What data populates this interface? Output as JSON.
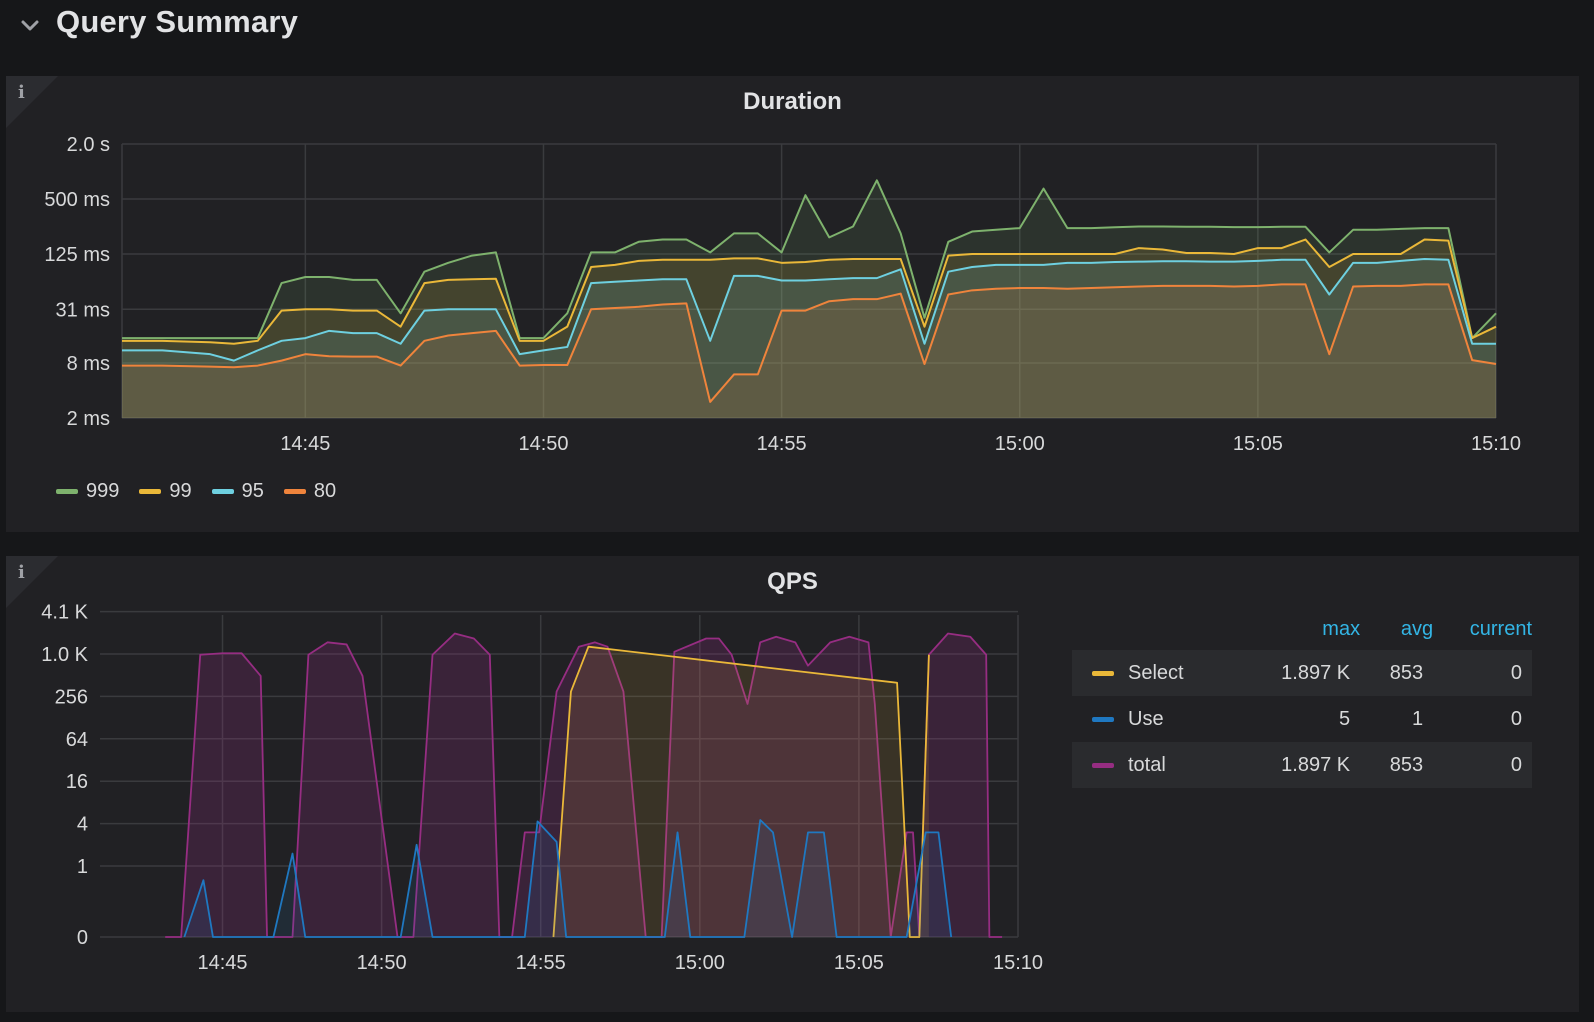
{
  "row": {
    "title": "Query Summary",
    "chevron_icon": "chevron-down-icon"
  },
  "panels": {
    "duration": {
      "title": "Duration",
      "info_icon": "i",
      "legend": [
        {
          "name": "999",
          "color": "#7eb26d"
        },
        {
          "name": "99",
          "color": "#eab839"
        },
        {
          "name": "95",
          "color": "#6ed0e0"
        },
        {
          "name": "80",
          "color": "#ef843c"
        }
      ]
    },
    "qps": {
      "title": "QPS",
      "info_icon": "i",
      "legend_table": {
        "headers": [
          "max",
          "avg",
          "current"
        ],
        "rows": [
          {
            "name": "Select",
            "color": "#eab839",
            "max": "1.897 K",
            "avg": "853",
            "current": "0"
          },
          {
            "name": "Use",
            "color": "#1f78c1",
            "max": "5",
            "avg": "1",
            "current": "0"
          },
          {
            "name": "total",
            "color": "#962d82",
            "max": "1.897 K",
            "avg": "853",
            "current": "0"
          }
        ]
      }
    }
  },
  "chart_data": [
    {
      "type": "area",
      "title": "Duration",
      "y_scale": "log",
      "y_ticks": [
        "2.0 s",
        "500 ms",
        "125 ms",
        "31 ms",
        "8 ms",
        "2 ms"
      ],
      "y_tick_values_ms": [
        2000,
        500,
        125,
        31,
        8,
        2
      ],
      "ylim_ms": [
        2,
        2000
      ],
      "x_ticks": [
        "14:45",
        "14:50",
        "14:55",
        "15:00",
        "15:05",
        "15:10"
      ],
      "x_tick_minutes": [
        45,
        50,
        55,
        60,
        65,
        70
      ],
      "xlim_minutes": [
        41.15,
        70
      ],
      "grid": true,
      "legend_position": "bottom-left",
      "x_minutes": [
        41.15,
        42,
        43,
        43.5,
        44,
        44.5,
        45,
        45.5,
        46,
        46.5,
        47,
        47.5,
        48,
        48.5,
        49,
        49.5,
        50,
        50.5,
        51,
        51.5,
        52,
        52.5,
        53,
        53.5,
        54,
        54.5,
        55,
        55.5,
        56,
        56.5,
        57,
        57.5,
        58,
        58.5,
        59,
        59.5,
        60,
        60.5,
        61,
        61.5,
        62,
        62.5,
        63,
        63.5,
        64,
        64.5,
        65,
        65.5,
        66,
        66.5,
        67,
        67.5,
        68,
        68.5,
        69,
        69.5,
        70
      ],
      "series": [
        {
          "name": "999",
          "color": "#7eb26d",
          "values": [
            15,
            15,
            15,
            15,
            15,
            60,
            70,
            70,
            65,
            65,
            28,
            80,
            100,
            120,
            130,
            15,
            15,
            28,
            130,
            130,
            170,
            180,
            180,
            130,
            210,
            210,
            130,
            550,
            190,
            250,
            800,
            210,
            25,
            170,
            220,
            230,
            240,
            650,
            240,
            240,
            245,
            250,
            250,
            248,
            248,
            246,
            246,
            248,
            248,
            130,
            230,
            230,
            235,
            240,
            240,
            15,
            28
          ]
        },
        {
          "name": "99",
          "color": "#eab839",
          "values": [
            14,
            14,
            13.5,
            13,
            14,
            30,
            31,
            31,
            30,
            30,
            20,
            60,
            65,
            66,
            67,
            14,
            14,
            20,
            90,
            95,
            105,
            108,
            108,
            108,
            112,
            112,
            100,
            102,
            108,
            110,
            110,
            110,
            20,
            120,
            125,
            125,
            125,
            125,
            125,
            125,
            125,
            145,
            140,
            128,
            128,
            125,
            145,
            145,
            180,
            90,
            125,
            125,
            125,
            180,
            175,
            15,
            20
          ]
        },
        {
          "name": "95",
          "color": "#6ed0e0",
          "values": [
            11,
            11,
            10,
            8.5,
            11,
            14,
            15,
            18,
            17,
            17,
            13,
            30,
            31,
            31,
            31,
            10,
            11,
            12,
            60,
            62,
            64,
            66,
            66,
            14,
            72,
            72,
            64,
            64,
            66,
            68,
            68,
            85,
            13,
            80,
            90,
            95,
            95,
            95,
            100,
            100,
            102,
            103,
            104,
            104,
            103,
            103,
            105,
            108,
            108,
            45,
            100,
            100,
            105,
            110,
            108,
            13,
            13
          ]
        },
        {
          "name": "80",
          "color": "#ef843c",
          "values": [
            7.5,
            7.5,
            7.3,
            7.2,
            7.5,
            8.5,
            10,
            9.5,
            9.4,
            9.4,
            7.5,
            14,
            16,
            17,
            18,
            7.5,
            7.6,
            7.6,
            31,
            32,
            33,
            35,
            36,
            3,
            6,
            6,
            30,
            30,
            38,
            40,
            40,
            46,
            7.8,
            45,
            50,
            52,
            53,
            53,
            52,
            53,
            54,
            55,
            56,
            56,
            56,
            55,
            56,
            58,
            58,
            10,
            55,
            56,
            56,
            58,
            58,
            8.6,
            7.8
          ]
        }
      ]
    },
    {
      "type": "area",
      "title": "QPS",
      "y_scale": "log",
      "y_ticks": [
        "4.1 K",
        "1.0 K",
        "256",
        "64",
        "16",
        "4",
        "1",
        "0"
      ],
      "y_tick_values": [
        4096,
        1024,
        256,
        64,
        16,
        4,
        1,
        0
      ],
      "x_ticks": [
        "14:45",
        "14:50",
        "14:55",
        "15:00",
        "15:05",
        "15:10"
      ],
      "x_tick_minutes": [
        45,
        50,
        55,
        60,
        65,
        70
      ],
      "xlim_minutes": [
        41.15,
        70
      ],
      "grid": true,
      "legend_position": "right",
      "series": [
        {
          "name": "total",
          "color": "#962d82",
          "x_minutes": [
            43.2,
            43.7,
            44.3,
            45,
            45.6,
            46.2,
            46.4,
            47.2,
            47.7,
            48.3,
            48.9,
            49.4,
            50.5,
            51,
            51.6,
            52.3,
            52.9,
            53.4,
            53.7,
            54.1,
            54.5,
            54.95,
            55.5,
            56.2,
            56.7,
            57.1,
            57.6,
            58.3,
            58.8,
            59.2,
            60.2,
            60.6,
            61,
            61.5,
            61.9,
            62.4,
            63,
            63.4,
            64.1,
            64.7,
            65.3,
            65.5,
            66,
            66.5,
            66.6,
            66.7,
            66.9,
            67.2,
            67.8,
            68.5,
            69,
            69.1,
            69.5
          ],
          "values": [
            0,
            0,
            1000,
            1050,
            1050,
            500,
            0,
            0,
            1000,
            1500,
            1400,
            500,
            0,
            0,
            1000,
            2000,
            1700,
            1000,
            0,
            0,
            3,
            3,
            300,
            1300,
            1500,
            1300,
            300,
            0,
            0,
            1100,
            1700,
            1700,
            1000,
            200,
            1500,
            1800,
            1500,
            700,
            1500,
            1800,
            1500,
            200,
            0,
            3,
            3,
            3,
            0,
            1000,
            2000,
            1800,
            1000,
            0,
            0
          ]
        },
        {
          "name": "Select",
          "color": "#eab839",
          "x_minutes": [
            55.4,
            55.95,
            56.5,
            66.2,
            66.6,
            66.9,
            67.2
          ],
          "values": [
            0,
            300,
            1300,
            400,
            0,
            0,
            1000
          ]
        },
        {
          "name": "Use",
          "color": "#1f78c1",
          "x_minutes": [
            43.8,
            44.4,
            44.7,
            46.6,
            47.2,
            47.6,
            50.6,
            51.1,
            51.6,
            54.5,
            54.9,
            55.5,
            55.8,
            58.9,
            59.3,
            59.7,
            61.4,
            61.9,
            62.3,
            62.9,
            63.4,
            63.9,
            64.3,
            66.5,
            67.1,
            67.5,
            67.9
          ],
          "values": [
            0,
            0.8,
            0,
            0,
            1.5,
            0,
            0,
            2,
            0,
            0,
            4.3,
            2.2,
            0,
            0,
            3,
            0,
            0,
            4.5,
            3,
            0,
            3,
            3,
            0,
            0,
            3,
            3,
            0
          ]
        }
      ]
    }
  ]
}
